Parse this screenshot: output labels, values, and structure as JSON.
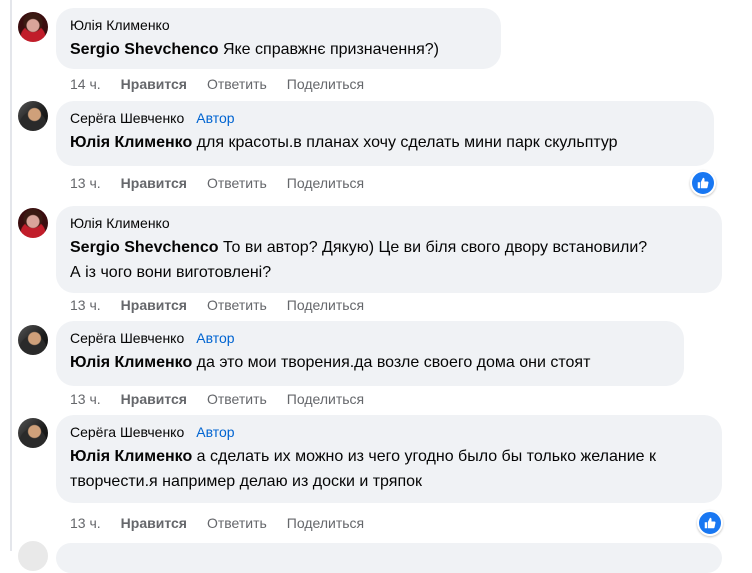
{
  "comments": [
    {
      "author": "Юлія Клименко",
      "badge": "",
      "mention": "Sergio Shevchenco",
      "text": " Яке справжнє призначення?)",
      "time": "14 ч.",
      "like": "Нравится",
      "reply": "Ответить",
      "share": "Поделиться",
      "reaction": false
    },
    {
      "author": "Серёга Шевченко",
      "badge": "Автор",
      "mention": "Юлія Клименко",
      "text": " для красоты.в планах хочу сделать мини парк скульптур",
      "time": "13 ч.",
      "like": "Нравится",
      "reply": "Ответить",
      "share": "Поделиться",
      "reaction": true
    },
    {
      "author": "Юлія Клименко",
      "badge": "",
      "mention": "Sergio Shevchenco",
      "text": " То ви автор? Дякую) Це ви біля свого двору встановили? А із чого вони виготовлені?",
      "time": "13 ч.",
      "like": "Нравится",
      "reply": "Ответить",
      "share": "Поделиться",
      "reaction": false
    },
    {
      "author": "Серёга Шевченко",
      "badge": "Автор",
      "mention": "Юлія Клименко",
      "text": " да это мои творения.да возле своего дома они стоят",
      "time": "13 ч.",
      "like": "Нравится",
      "reply": "Ответить",
      "share": "Поделиться",
      "reaction": false
    },
    {
      "author": "Серёга Шевченко",
      "badge": "Автор",
      "mention": "Юлія Клименко",
      "text": " а сделать их можно из чего угодно было бы только желание к творчести.я например делаю из доски и тряпок",
      "time": "13 ч.",
      "like": "Нравится",
      "reply": "Ответить",
      "share": "Поделиться",
      "reaction": true
    }
  ],
  "colors": {
    "bubble": "#f0f2f5",
    "author_badge": "#0064d1",
    "meta_text": "#65676b",
    "like_reaction": "#1877f2"
  },
  "icons": {
    "reaction": "thumbs-up-icon"
  }
}
